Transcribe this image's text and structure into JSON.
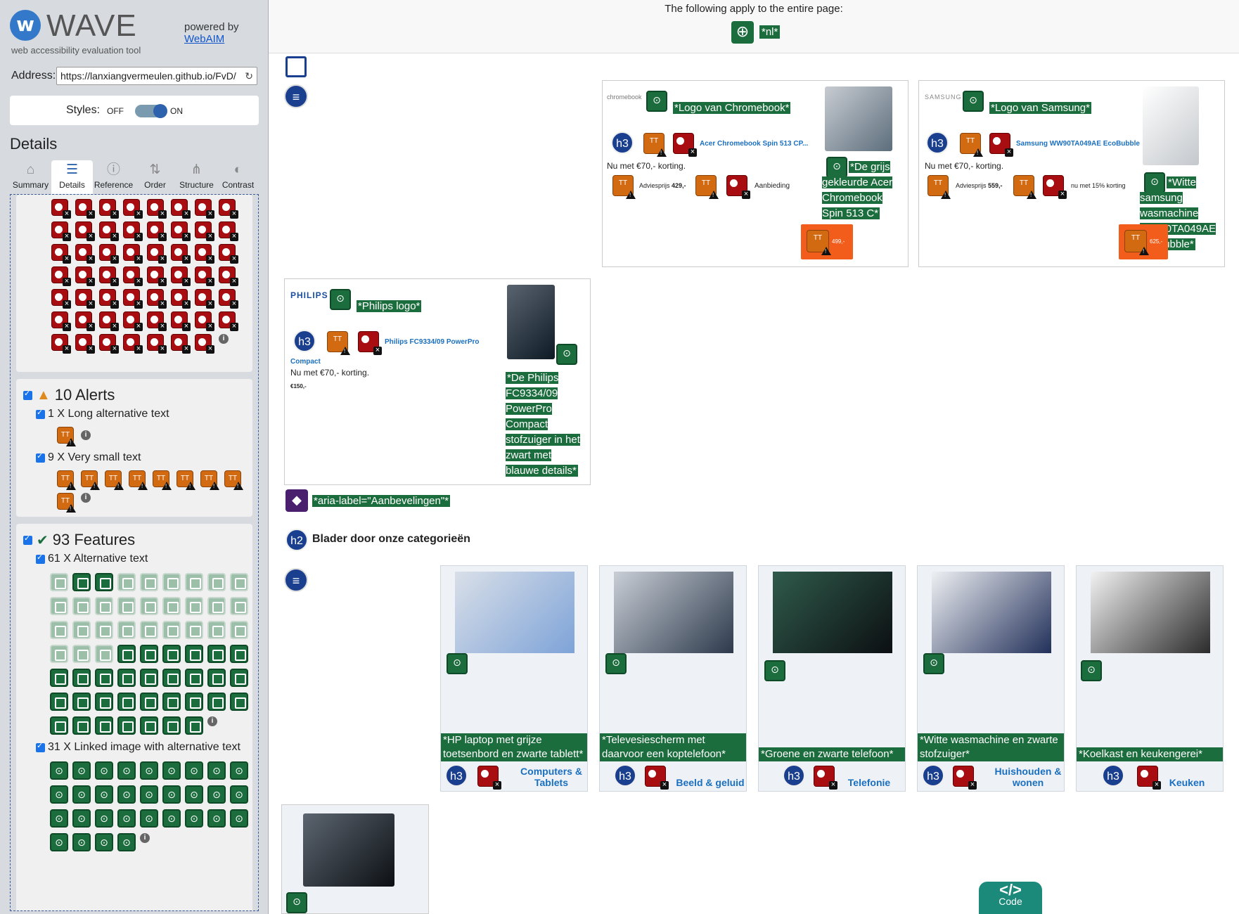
{
  "sidebar": {
    "logo_letter": "w",
    "title": "WAVE",
    "subtitle": "web accessibility evaluation tool",
    "powered_by": "powered by",
    "webaim": "WebAIM",
    "address_label": "Address:",
    "address_value": "https://lanxiangvermeulen.github.io/FvD/",
    "styles_label": "Styles:",
    "styles_off": "OFF",
    "styles_on": "ON",
    "details_heading": "Details",
    "tabs": [
      {
        "label": "Summary",
        "icon": "⌂"
      },
      {
        "label": "Details",
        "icon": "☰"
      },
      {
        "label": "Reference",
        "icon": "ⓘ"
      },
      {
        "label": "Order",
        "icon": "⇅"
      },
      {
        "label": "Structure",
        "icon": "⋔"
      },
      {
        "label": "Contrast",
        "icon": "◐"
      }
    ],
    "alerts": {
      "heading": "10 Alerts",
      "items": [
        {
          "label": "1 X Long alternative text"
        },
        {
          "label": "9 X Very small text"
        }
      ]
    },
    "features": {
      "heading": "93 Features",
      "items": [
        {
          "label": "61 X Alternative text"
        },
        {
          "label": "31 X Linked image with alternative text"
        }
      ]
    },
    "alert_small_text": "TT"
  },
  "main": {
    "top_text": "The following apply to the entire page:",
    "lang_label": "*nl*",
    "products": [
      {
        "logo": "chromebook",
        "logo_alt": "*Logo van Chromebook*",
        "name": "Acer Chromebook Spin 513 CP...",
        "discount": "Nu met €70,- korting.",
        "advice": "Adviesprijs",
        "advice_price": "429,-",
        "offer": "Aanbieding",
        "img_alt": "*De grijs gekleurde Acer Chromebook Spin 513 C*",
        "price": "499,-"
      },
      {
        "logo": "SAMSUNG",
        "logo_alt": "*Logo van Samsung*",
        "name": "Samsung WW90TA049AE EcoBubble",
        "discount": "Nu met €70,- korting.",
        "advice": "Adviesprijs",
        "advice_price": "559,-",
        "offer": "nu met 15% korting",
        "img_alt": "*Witte samsung wasmachine WW90TA049AE Ecobubble*",
        "price": "625,-"
      },
      {
        "logo": "PHILIPS",
        "logo_alt": "*Philips logo*",
        "name": "Philips FC9334/09 PowerPro",
        "name2": "Compact",
        "discount": "Nu met €70,- korting.",
        "price": "€150,-",
        "img_alt": "*De Philips FC9334/09 PowerPro Compact stofzuiger in het zwart met blauwe details*"
      }
    ],
    "aria_label": "*aria-label=\"Aanbevelingen\"*",
    "h2_icon": "h2",
    "h3_icon": "h3",
    "categories_heading": "Blader door onze categorieën",
    "categories": [
      {
        "alt": "*HP laptop met grijze toetsenbord en zwarte tablett*",
        "name": "Computers & Tablets"
      },
      {
        "alt": "*Televesiescherm met daarvoor een koptelefoon*",
        "name": "Beeld & geluid"
      },
      {
        "alt": "*Groene en zwarte telefoon*",
        "name": "Telefonie"
      },
      {
        "alt": "*Witte wasmachine en zwarte stofzuiger*",
        "name": "Huishouden & wonen"
      },
      {
        "alt": "*Koelkast en keukengerei*",
        "name": "Keuken"
      }
    ],
    "code_label": "Code",
    "code_icon": "</>"
  }
}
